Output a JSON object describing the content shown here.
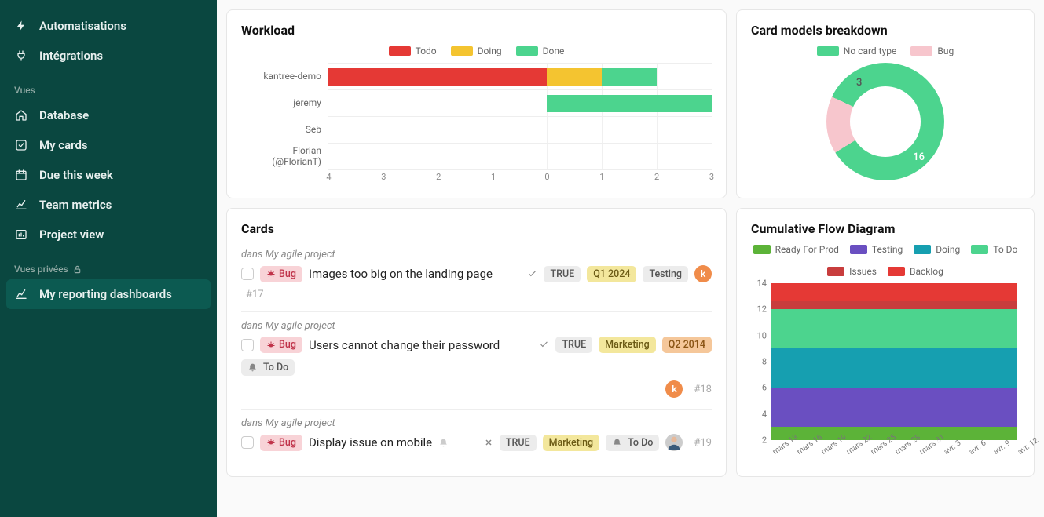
{
  "sidebar": {
    "items_top": [
      {
        "label": "Automatisations",
        "icon": "bolt"
      },
      {
        "label": "Intégrations",
        "icon": "plug"
      }
    ],
    "section1_label": "Vues",
    "items_views": [
      {
        "label": "Database",
        "icon": "home"
      },
      {
        "label": "My cards",
        "icon": "check-square"
      },
      {
        "label": "Due this week",
        "icon": "calendar"
      },
      {
        "label": "Team metrics",
        "icon": "chart-line"
      },
      {
        "label": "Project view",
        "icon": "analytics"
      }
    ],
    "section2_label": "Vues privées",
    "items_private": [
      {
        "label": "My reporting dashboards",
        "icon": "chart-line",
        "active": true
      }
    ]
  },
  "workload": {
    "title": "Workload",
    "legend": [
      {
        "label": "Todo",
        "color": "#e53935"
      },
      {
        "label": "Doing",
        "color": "#f4c430"
      },
      {
        "label": "Done",
        "color": "#4cd48e"
      }
    ],
    "axis_ticks": [
      "-4",
      "-3",
      "-2",
      "-1",
      "0",
      "1",
      "2",
      "3"
    ],
    "chart_data": {
      "type": "bar-stacked-horizontal",
      "x_range": [
        -4,
        3
      ],
      "series": [
        "Todo",
        "Doing",
        "Done"
      ],
      "rows": [
        {
          "label": "kantree-demo",
          "Todo": -4,
          "Doing": 1,
          "Done": 1
        },
        {
          "label": "jeremy",
          "Todo": 0,
          "Doing": 0,
          "Done": 3
        },
        {
          "label": "Seb",
          "Todo": 0,
          "Doing": 0,
          "Done": 0
        },
        {
          "label": "Florian (@FlorianT)",
          "Todo": 0,
          "Doing": 0,
          "Done": 0
        }
      ]
    }
  },
  "breakdown": {
    "title": "Card models breakdown",
    "legend": [
      {
        "label": "No card type",
        "color": "#4cd48e"
      },
      {
        "label": "Bug",
        "color": "#f7c6cd"
      }
    ],
    "chart_data": {
      "type": "donut",
      "slices": [
        {
          "label": "No card type",
          "value": 16,
          "color": "#4cd48e"
        },
        {
          "label": "Bug",
          "value": 3,
          "color": "#f7c6cd"
        }
      ]
    }
  },
  "cards": {
    "title": "Cards",
    "project_prefix": "dans",
    "items": [
      {
        "project": "My agile project",
        "bug_label": "Bug",
        "title": "Images too big on the landing page",
        "true_label": "TRUE",
        "quarter": "Q1 2024",
        "status": "Testing",
        "avatar_letter": "k",
        "num": "#17",
        "check_icon": true
      },
      {
        "project": "My agile project",
        "bug_label": "Bug",
        "title": "Users cannot change their password",
        "true_label": "TRUE",
        "dept": "Marketing",
        "quarter": "Q2 2014",
        "status": "To Do",
        "bell": true,
        "avatar_letter": "k",
        "num": "#18",
        "check_icon": true
      },
      {
        "project": "My agile project",
        "bug_label": "Bug",
        "title": "Display issue on mobile",
        "muted_bell": true,
        "true_label": "TRUE",
        "dept": "Marketing",
        "status": "To Do",
        "bell": true,
        "avatar_photo": true,
        "num": "#19",
        "x_icon": true
      }
    ]
  },
  "cfd": {
    "title": "Cumulative Flow Diagram",
    "legend": [
      {
        "label": "Ready For Prod",
        "color": "#5cb338"
      },
      {
        "label": "Testing",
        "color": "#6a4fc1"
      },
      {
        "label": "Doing",
        "color": "#169fb0"
      },
      {
        "label": "To Do",
        "color": "#4cd48e"
      },
      {
        "label": "Issues",
        "color": "#c83d3d"
      },
      {
        "label": "Backlog",
        "color": "#e53935"
      }
    ],
    "y_ticks": [
      "14",
      "12",
      "10",
      "8",
      "6",
      "4",
      "2"
    ],
    "x_ticks": [
      "mars 13",
      "mars 16",
      "mars 19",
      "mars 22",
      "mars 25",
      "mars 28",
      "mars 31",
      "avr. 3",
      "avr. 6",
      "avr. 9",
      "avr. 12"
    ],
    "chart_data": {
      "type": "area-stacked",
      "y_range": [
        2,
        14
      ],
      "bands": [
        {
          "label": "Ready For Prod",
          "from": 2,
          "to": 3,
          "color": "#5cb338"
        },
        {
          "label": "Testing",
          "from": 3,
          "to": 6,
          "color": "#6a4fc1"
        },
        {
          "label": "Doing",
          "from": 6,
          "to": 9,
          "color": "#169fb0"
        },
        {
          "label": "To Do",
          "from": 9,
          "to": 12,
          "color": "#4cd48e"
        },
        {
          "label": "Issues",
          "from": 12,
          "to": 12.6,
          "color": "#c83d3d"
        },
        {
          "label": "Backlog",
          "from": 12.6,
          "to": 14,
          "color": "#e53935"
        }
      ]
    }
  }
}
